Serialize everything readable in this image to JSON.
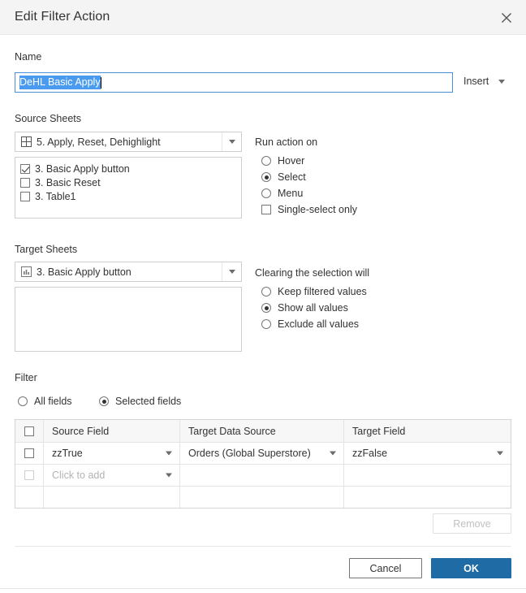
{
  "dialog": {
    "title": "Edit Filter Action",
    "close_icon": "close-icon"
  },
  "name_section": {
    "label": "Name",
    "value": "DeHL Basic Apply",
    "selected": true,
    "insert_label": "Insert"
  },
  "source_sheets": {
    "label": "Source Sheets",
    "dropdown_icon": "dashboard-grid-icon",
    "dropdown_value": "5. Apply, Reset, Dehighlight",
    "items": [
      {
        "label": "3. Basic Apply button",
        "checked": true
      },
      {
        "label": "3. Basic Reset",
        "checked": false
      },
      {
        "label": "3. Table1",
        "checked": false
      }
    ]
  },
  "run_action": {
    "label": "Run action on",
    "options": [
      {
        "label": "Hover",
        "selected": false
      },
      {
        "label": "Select",
        "selected": true
      },
      {
        "label": "Menu",
        "selected": false
      }
    ],
    "single_select_only": {
      "label": "Single-select only",
      "checked": false
    }
  },
  "target_sheets": {
    "label": "Target Sheets",
    "dropdown_icon": "worksheet-icon",
    "dropdown_value": "3. Basic Apply button",
    "items": []
  },
  "clearing": {
    "label": "Clearing the selection will",
    "options": [
      {
        "label": "Keep filtered values",
        "selected": false
      },
      {
        "label": "Show all values",
        "selected": true
      },
      {
        "label": "Exclude all values",
        "selected": false
      }
    ]
  },
  "filter": {
    "label": "Filter",
    "scope_options": [
      {
        "label": "All fields",
        "selected": false
      },
      {
        "label": "Selected fields",
        "selected": true
      }
    ],
    "table": {
      "select_all_checked": false,
      "headers": [
        "Source Field",
        "Target Data Source",
        "Target Field"
      ],
      "rows": [
        {
          "checked": false,
          "checkbox_disabled": false,
          "source_field": "zzTrue",
          "target_data_source": "Orders (Global Superstore)",
          "target_field": "zzFalse",
          "placeholder": false
        },
        {
          "checked": false,
          "checkbox_disabled": true,
          "source_field": "Click to add",
          "target_data_source": "",
          "target_field": "",
          "placeholder": true
        }
      ]
    },
    "remove_label": "Remove",
    "remove_disabled": true
  },
  "footer": {
    "cancel_label": "Cancel",
    "ok_label": "OK"
  },
  "colors": {
    "primary": "#1f6ba5",
    "selection": "#4a9bf0",
    "focus_border": "#4a90d9",
    "titlebar_bg": "#f4f4f4"
  }
}
